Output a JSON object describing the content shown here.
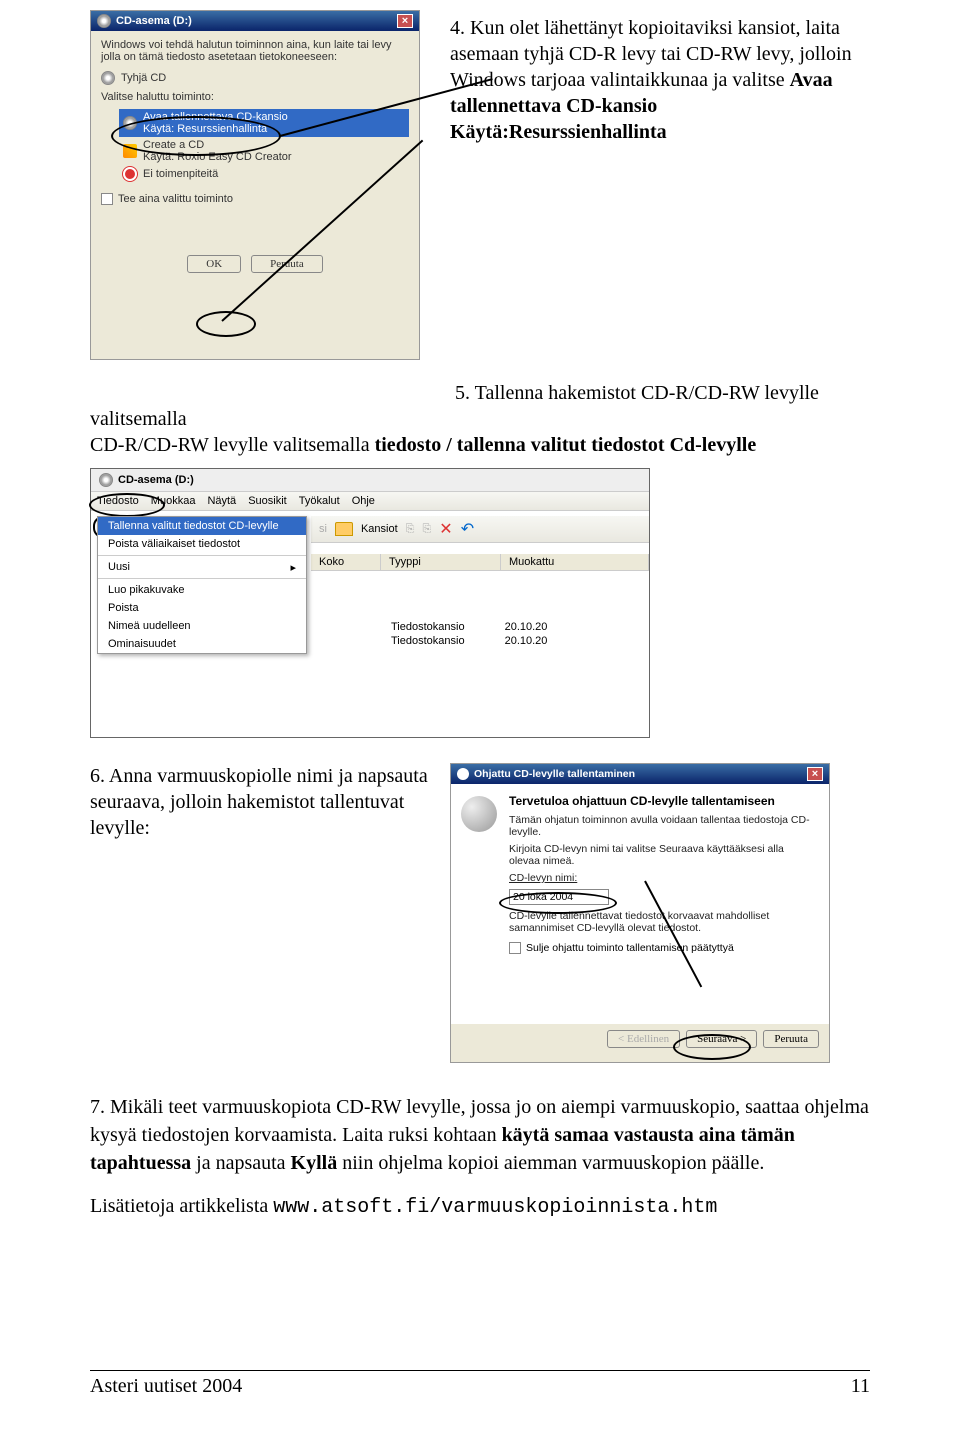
{
  "step4": {
    "num": "4.",
    "text_a": "Kun olet lähettänyt kopioitaviksi kansiot, laita asemaan tyhjä CD-R levy tai CD-RW levy, jolloin Windows tarjoaa valintaikkunaa ja valitse ",
    "bold_a": "Avaa tallennettava CD-kansio",
    "bold_b": " Käytä:Resurssienhallinta"
  },
  "ss1": {
    "title": "CD-asema (D:)",
    "intro": "Windows voi tehdä halutun toiminnon aina, kun laite tai levy jolla on tämä tiedosto asetetaan tietokoneeseen:",
    "radio1": "Tyhjä CD",
    "radio2": "Valitse haluttu toiminto:",
    "item_sel1": "Avaa tallennettava CD-kansio",
    "item_sel2": "Käytä: Resurssienhallinta",
    "item_a1": "Create a CD",
    "item_a2": "Käytä: Roxio Easy CD Creator",
    "item_b1": "Ei toimenpiteitä",
    "chk": "Tee aina valittu toiminto",
    "ok": "OK",
    "cancel": "Peruuta"
  },
  "step5": {
    "num": "5.",
    "text_a": "Tallenna hakemistot CD-R/CD-RW levylle valitsemalla ",
    "bold_a": "tiedosto / tallenna valitut tiedostot Cd-levylle"
  },
  "ss2": {
    "addr": "CD-asema (D:)",
    "menu": [
      "Tiedosto",
      "Muokkaa",
      "Näytä",
      "Suosikit",
      "Työkalut",
      "Ohje"
    ],
    "dd": {
      "sel": "Tallenna valitut tiedostot CD-levylle",
      "poista": "Poista väliaikaiset tiedostot",
      "uusi": "Uusi",
      "luo": "Luo pikakuvake",
      "poista2": "Poista",
      "nimea": "Nimeä uudelleen",
      "omin": "Ominaisuudet"
    },
    "tool_kansiot": "Kansiot",
    "headers": [
      "Koko",
      "Tyyppi",
      "Muokattu"
    ],
    "rows": [
      {
        "t": "Tiedostokansio",
        "d": "20.10.20"
      },
      {
        "t": "Tiedostokansio",
        "d": "20.10.20"
      }
    ]
  },
  "step6": {
    "num": "6.",
    "text": "Anna varmuuskopiolle nimi ja napsauta seuraava, jolloin hakemistot tallentuvat levylle:"
  },
  "ss3": {
    "title": "Ohjattu CD-levylle tallentaminen",
    "h": "Tervetuloa ohjattuun CD-levylle tallentamiseen",
    "p1": "Tämän ohjatun toiminnon avulla voidaan tallentaa tiedostoja CD-levylle.",
    "p2": "Kirjoita CD-levyn nimi tai valitse Seuraava käyttääksesi alla olevaa nimeä.",
    "label": "CD-levyn nimi:",
    "value": "20 loka 2004",
    "p3": "CD-levylle tallennettavat tiedostot korvaavat mahdolliset samannimiset CD-levyllä olevat tiedostot.",
    "chk": "Sulje ohjattu toiminto tallentamisen päätyttyä",
    "back": "< Edellinen",
    "next": "Seuraava >",
    "cancel": "Peruuta"
  },
  "step7": {
    "num": "7.",
    "text_a": "Mikäli teet varmuuskopiota CD-RW levylle, jossa jo on aiempi varmuuskopio, saattaa ohjelma kysyä tiedostojen korvaamista. Laita ruksi kohtaan ",
    "bold_a": "käytä samaa vastausta aina tämän tapahtuessa",
    "text_b": " ja napsauta ",
    "bold_b": "Kyllä",
    "text_c": " niin ohjelma kopioi aiemman varmuuskopion päälle."
  },
  "more_info": {
    "text": "Lisätietoja artikkelista ",
    "url": "www.atsoft.fi/varmuuskopioinnista.htm"
  },
  "footer": {
    "left": "Asteri uutiset 2004",
    "right": "11"
  }
}
